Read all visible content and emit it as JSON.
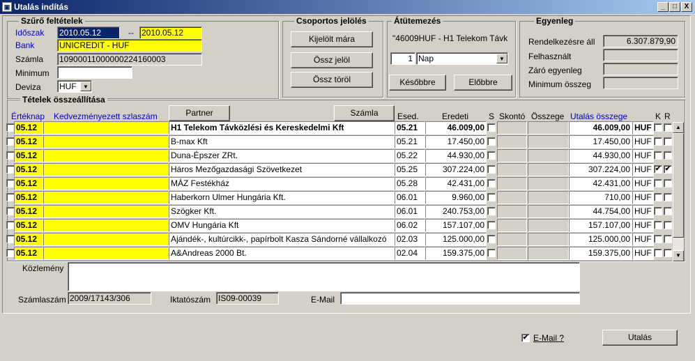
{
  "window": {
    "title": "Utalás indítás",
    "minimize": "_",
    "maximize": "□",
    "close": "X"
  },
  "filter": {
    "title": "Szűrő feltételek",
    "period_label": "Időszak",
    "period_from": "2010.05.12",
    "period_sep": "--",
    "period_to": "2010.05.12",
    "bank_label": "Bank",
    "bank_value": "UNICREDIT - HUF",
    "account_label": "Számla",
    "account_value": "10900011000000224160003",
    "minimum_label": "Minimum",
    "minimum_value": "",
    "currency_label": "Deviza",
    "currency_value": "HUF"
  },
  "group_mark": {
    "title": "Csoportos jelölés",
    "btn_marked_today": "Kijelölt mára",
    "btn_mark_all": "Össz jelöl",
    "btn_clear_all": "Össz töröl"
  },
  "reschedule": {
    "title": "Átütemezés",
    "item": "\"46009HUF - H1 Telekom Távk",
    "count": "1",
    "unit": "Nap",
    "btn_later": "Későbbre",
    "btn_earlier": "Előbbre"
  },
  "balance": {
    "title": "Egyenleg",
    "available_label": "Rendelkezésre áll",
    "available_value": "6.307.879,90",
    "used_label": "Felhasznált",
    "used_value": "",
    "closing_label": "Záró egyenleg",
    "closing_value": "",
    "min_label": "Minimum összeg",
    "min_value": ""
  },
  "items": {
    "title": "Tételek összeállítása",
    "btn_partner": "Partner",
    "btn_invoice": "Számla",
    "col_value_day": "Értéknap",
    "col_beneficiary": "Kedvezményezett szlaszám",
    "col_due": "Esed.",
    "col_original": "Eredeti",
    "col_s": "S",
    "col_discount": "Skontó",
    "col_amount": "Összege",
    "col_transfer": "Utalás összege",
    "col_k": "K",
    "col_r": "R",
    "rows": [
      {
        "date": "05.12",
        "account": "",
        "partner": "H1 Telekom Távközlési és Kereskedelmi Kft",
        "due": "05.21",
        "original": "46.009,00",
        "transfer": "46.009,00",
        "cur": "HUF",
        "k": "",
        "r": ""
      },
      {
        "date": "05.12",
        "account": "",
        "partner": "B-max Kft",
        "due": "05.21",
        "original": "17.450,00",
        "transfer": "17.450,00",
        "cur": "HUF",
        "k": "",
        "r": ""
      },
      {
        "date": "05.12",
        "account": "",
        "partner": "Duna-Épszer ZRt.",
        "due": "05.22",
        "original": "44.930,00",
        "transfer": "44.930,00",
        "cur": "HUF",
        "k": "",
        "r": ""
      },
      {
        "date": "05.12",
        "account": "",
        "partner": "Háros Mezőgazdasági Szövetkezet",
        "due": "05.25",
        "original": "307.224,00",
        "transfer": "307.224,00",
        "cur": "HUF",
        "k": "✔",
        "r": "✔"
      },
      {
        "date": "05.12",
        "account": "",
        "partner": "MÁZ Festékház",
        "due": "05.28",
        "original": "42.431,00",
        "transfer": "42.431,00",
        "cur": "HUF",
        "k": "",
        "r": ""
      },
      {
        "date": "05.12",
        "account": "",
        "partner": "Haberkorn Ulmer Hungária Kft.",
        "due": "06.01",
        "original": "9.960,00",
        "transfer": "710,00",
        "cur": "HUF",
        "k": "",
        "r": ""
      },
      {
        "date": "05.12",
        "account": "",
        "partner": "Szögker Kft.",
        "due": "06.01",
        "original": "240.753,00",
        "transfer": "44.754,00",
        "cur": "HUF",
        "k": "",
        "r": ""
      },
      {
        "date": "05.12",
        "account": "",
        "partner": "OMV Hungária Kft",
        "due": "06.02",
        "original": "157.107,00",
        "transfer": "157.107,00",
        "cur": "HUF",
        "k": "",
        "r": ""
      },
      {
        "date": "05.12",
        "account": "",
        "partner": "Ajándék-, kultúrcikk-, papírbolt  Kasza Sándorné vállalkozó",
        "due": "02.03",
        "original": "125.000,00",
        "transfer": "125.000,00",
        "cur": "HUF",
        "k": "",
        "r": ""
      },
      {
        "date": "05.12",
        "account": "",
        "partner": "A&Andreas 2000 Bt.",
        "due": "02.04",
        "original": "159.375,00",
        "transfer": "159.375,00",
        "cur": "HUF",
        "k": "",
        "r": ""
      }
    ]
  },
  "footer": {
    "note_label": "Közlemény",
    "note_value": "",
    "invoice_no_label": "Számlaszám",
    "invoice_no_value": "2009/17143/306",
    "file_no_label": "Iktatószám",
    "file_no_value": "IS09-00039",
    "email_label": "E-Mail",
    "email_value": "",
    "email_check_label": "E-Mail ?",
    "email_checked": "✔",
    "btn_transfer": "Utalás"
  }
}
